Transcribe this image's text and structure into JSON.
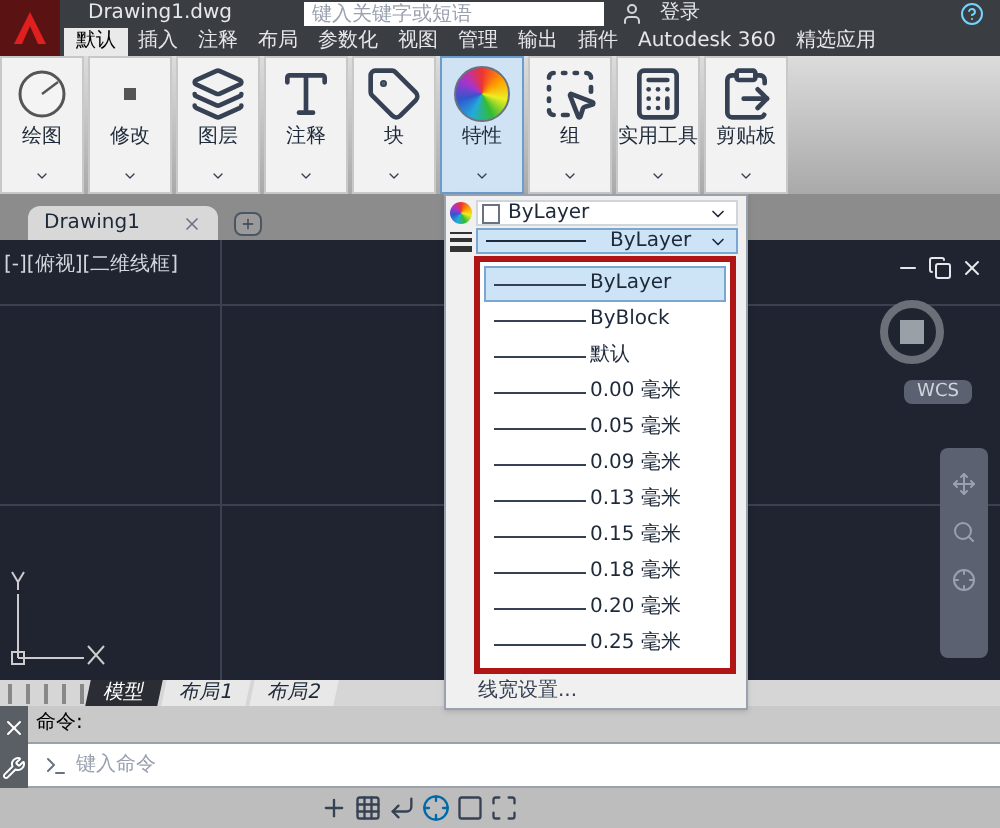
{
  "title_bar": {
    "file_name": "Drawing1.dwg",
    "search_placeholder": "键入关键字或短语",
    "sign_in": "登录"
  },
  "ribbon_tabs": [
    {
      "label": "默认",
      "selected": true
    },
    {
      "label": "插入",
      "selected": false
    },
    {
      "label": "注释",
      "selected": false
    },
    {
      "label": "布局",
      "selected": false
    },
    {
      "label": "参数化",
      "selected": false
    },
    {
      "label": "视图",
      "selected": false
    },
    {
      "label": "管理",
      "selected": false
    },
    {
      "label": "输出",
      "selected": false
    },
    {
      "label": "插件",
      "selected": false
    },
    {
      "label": "Autodesk 360",
      "selected": false
    },
    {
      "label": "精选应用",
      "selected": false
    }
  ],
  "ribbon_panels": [
    {
      "label": "绘图",
      "kind": "draw",
      "selected": false
    },
    {
      "label": "修改",
      "kind": "modify",
      "selected": false
    },
    {
      "label": "图层",
      "kind": "layers",
      "selected": false
    },
    {
      "label": "注释",
      "kind": "annotate",
      "selected": false
    },
    {
      "label": "块",
      "kind": "block",
      "selected": false
    },
    {
      "label": "特性",
      "kind": "properties",
      "selected": true
    },
    {
      "label": "组",
      "kind": "group",
      "selected": false
    },
    {
      "label": "实用工具",
      "kind": "utilities",
      "selected": false
    },
    {
      "label": "剪贴板",
      "kind": "clipboard",
      "selected": false
    }
  ],
  "document_tabs": [
    {
      "label": "Drawing1",
      "selected": true
    }
  ],
  "viewport_label": "[-][俯视][二维线框]",
  "wcs_label": "WCS",
  "properties_panel": {
    "color_combo": "ByLayer",
    "lineweight_combo": "ByLayer",
    "lineweight_options": [
      {
        "label": "ByLayer",
        "selected": true
      },
      {
        "label": "ByBlock",
        "selected": false
      },
      {
        "label": "默认",
        "selected": false
      },
      {
        "label": "0.00 毫米",
        "selected": false
      },
      {
        "label": "0.05 毫米",
        "selected": false
      },
      {
        "label": "0.09 毫米",
        "selected": false
      },
      {
        "label": "0.13 毫米",
        "selected": false
      },
      {
        "label": "0.15 毫米",
        "selected": false
      },
      {
        "label": "0.18 毫米",
        "selected": false
      },
      {
        "label": "0.20 毫米",
        "selected": false
      },
      {
        "label": "0.25 毫米",
        "selected": false
      }
    ],
    "settings_link": "线宽设置..."
  },
  "layout_tabs": [
    {
      "label": "模型",
      "selected": true
    },
    {
      "label": "布局1",
      "selected": false
    },
    {
      "label": "布局2",
      "selected": false
    }
  ],
  "command_line": {
    "history": "命令:",
    "placeholder": "键入命令"
  }
}
